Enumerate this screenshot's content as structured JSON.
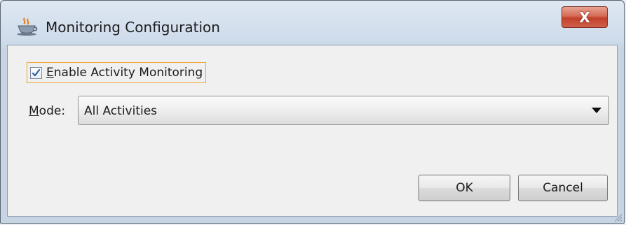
{
  "window": {
    "title": "Monitoring Configuration",
    "icon": "java-cup-icon",
    "close_label": "X"
  },
  "form": {
    "enable_checkbox": {
      "label_mnemonic": "E",
      "label_rest": "nable Activity Monitoring",
      "checked": true
    },
    "mode": {
      "label_mnemonic": "M",
      "label_rest": "ode:",
      "selected": "All Activities"
    }
  },
  "buttons": {
    "ok_label": "OK",
    "cancel_label": "Cancel"
  },
  "colors": {
    "focus_border": "#f2a431",
    "close_button": "#c2412a",
    "check_mark": "#2a5ea8"
  }
}
